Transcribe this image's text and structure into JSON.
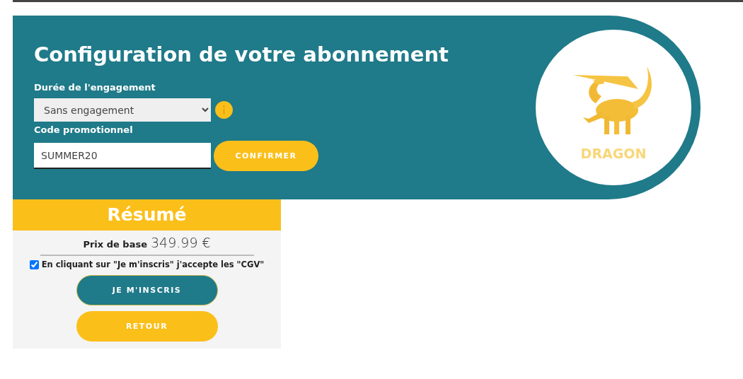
{
  "config": {
    "title": "Configuration de votre abonnement",
    "duration": {
      "label": "Durée de l'engagement",
      "value": "Sans engagement"
    },
    "promo": {
      "label": "Code promotionnel",
      "value": "SUMMER20",
      "button": "CONFIRMER"
    },
    "logo": {
      "name": "DRAGON"
    }
  },
  "summary": {
    "title": "Résumé",
    "price_label": "Prix de base",
    "price": "349.99 €",
    "terms": {
      "text": "En cliquant sur \"Je m'inscris\" j'accepte les **\"CGV\"**",
      "checked": true
    },
    "buttons": [
      {
        "label": "JE M'INSCRIS",
        "kind": "primary"
      },
      {
        "label": "RETOUR",
        "kind": "secondary"
      }
    ]
  }
}
